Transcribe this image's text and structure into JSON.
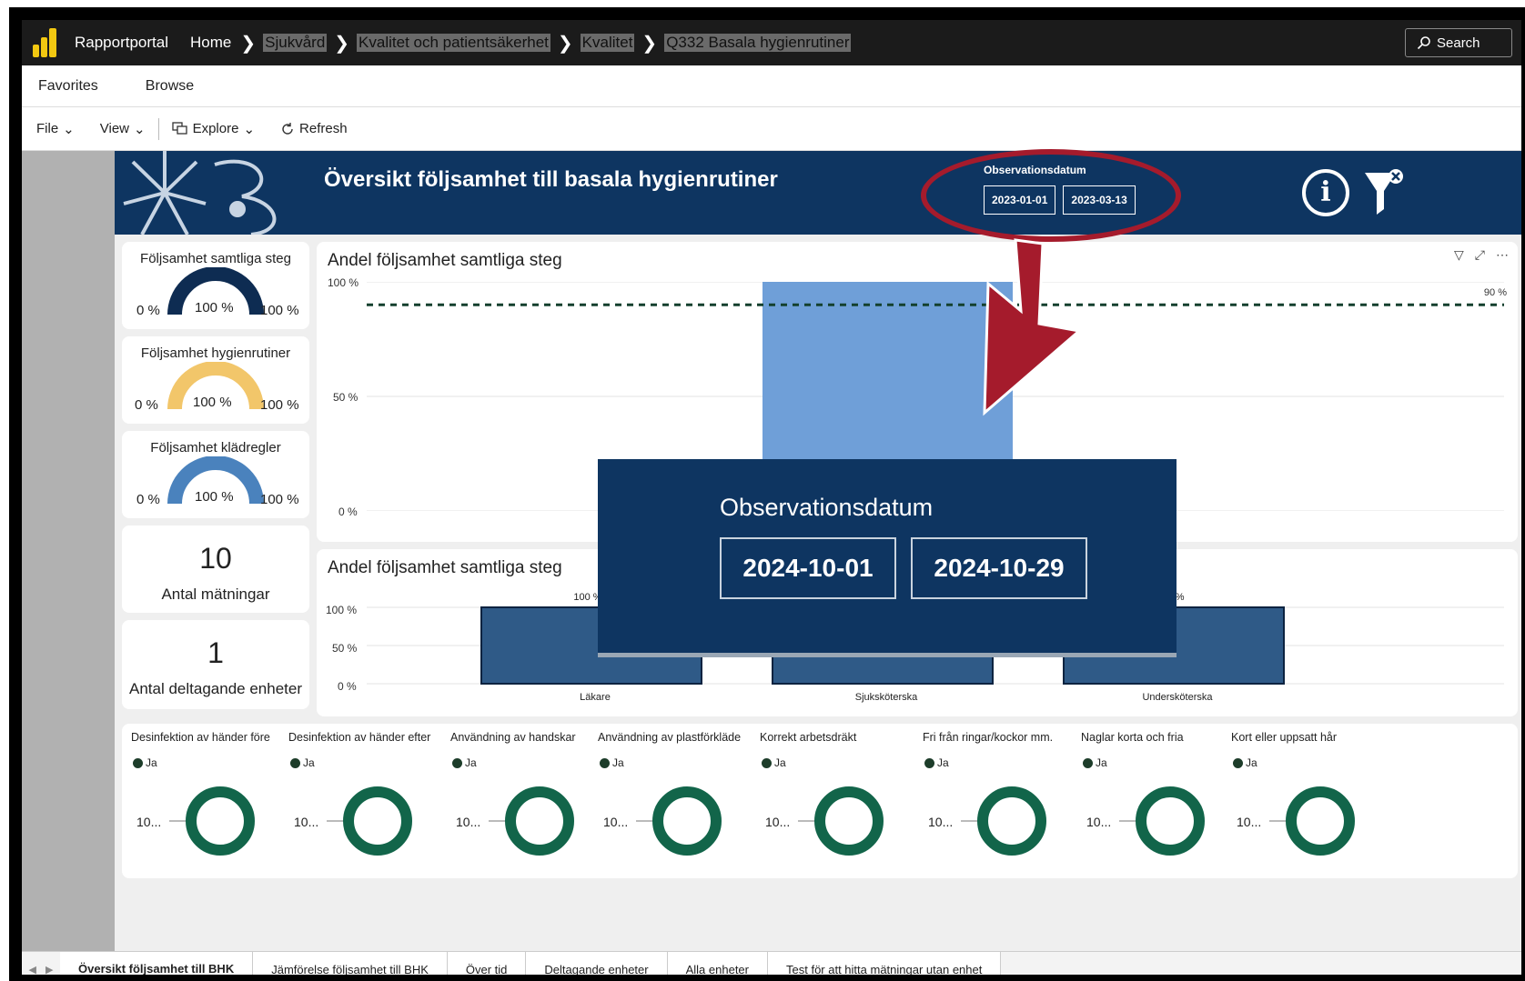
{
  "topbar": {
    "brand": "Rapportportal",
    "breadcrumbs": [
      "Home",
      "Sjukvård",
      "Kvalitet och patientsäkerhet",
      "Kvalitet",
      "Q332 Basala hygienrutiner"
    ],
    "search_label": "Search"
  },
  "nav": {
    "favorites": "Favorites",
    "browse": "Browse"
  },
  "toolbar": {
    "file": "File",
    "view": "View",
    "explore": "Explore",
    "refresh": "Refresh"
  },
  "report": {
    "title": "Översikt följsamhet till basala hygienrutiner",
    "obs_label": "Observationsdatum",
    "date_from": "2023-01-01",
    "date_to": "2023-03-13"
  },
  "zoom_overlay": {
    "label": "Observationsdatum",
    "date_from": "2024-10-01",
    "date_to": "2024-10-29"
  },
  "gauges": [
    {
      "title": "Följsamhet samtliga steg",
      "min": "0 %",
      "max": "100 %",
      "value_label": "100 %",
      "value": 1.0,
      "color": "#0e2c52"
    },
    {
      "title": "Följsamhet hygienrutiner",
      "min": "0 %",
      "max": "100 %",
      "value_label": "100 %",
      "value": 1.0,
      "color": "#f2c66a"
    },
    {
      "title": "Följsamhet klädregler",
      "min": "0 %",
      "max": "100 %",
      "value_label": "100 %",
      "value": 1.0,
      "color": "#4a82bd"
    }
  ],
  "kpis": [
    {
      "value": "10",
      "label": "Antal mätningar"
    },
    {
      "value": "1",
      "label": "Antal deltagande enheter"
    }
  ],
  "chart1": {
    "title": "Andel följsamhet samtliga steg",
    "target_label": "90 %"
  },
  "chart2": {
    "title": "Andel följsamhet samtliga steg"
  },
  "chart_data": [
    {
      "type": "bar",
      "title": "Andel följsamhet samtliga steg",
      "yticks": [
        "100 %",
        "50 %",
        "0 %"
      ],
      "ylim": [
        0,
        100
      ],
      "target": 90,
      "target_label": "90 %",
      "values": [
        100
      ],
      "color": "#6f9fd8",
      "grid": true
    },
    {
      "type": "bar",
      "title": "Andel följsamhet samtliga steg",
      "categories": [
        "Läkare",
        "Sjuksköterska",
        "Undersköterska"
      ],
      "values": [
        100,
        100,
        100
      ],
      "value_labels": [
        "100 %",
        "100 %",
        "100 %"
      ],
      "yticks": [
        "100 %",
        "50 %",
        "0 %"
      ],
      "ylim": [
        0,
        100
      ],
      "color": "#2f5a87",
      "grid": true
    },
    {
      "type": "pie",
      "donuts": [
        {
          "title": "Desinfektion av händer före",
          "legend": "Ja",
          "label": "10..."
        },
        {
          "title": "Desinfektion av händer efter",
          "legend": "Ja",
          "label": "10..."
        },
        {
          "title": "Användning av handskar",
          "legend": "Ja",
          "label": "10..."
        },
        {
          "title": "Användning av plastförkläde",
          "legend": "Ja",
          "label": "10..."
        },
        {
          "title": "Korrekt arbetsdräkt",
          "legend": "Ja",
          "label": "10..."
        },
        {
          "title": "Fri från ringar/kockor mm.",
          "legend": "Ja",
          "label": "10..."
        },
        {
          "title": "Naglar korta och fria",
          "legend": "Ja",
          "label": "10..."
        },
        {
          "title": "Kort eller uppsatt hår",
          "legend": "Ja",
          "label": "10..."
        }
      ],
      "color": "#12654a"
    }
  ],
  "tabs": [
    "Översikt följsamhet till BHK",
    "Jämförelse följsamhet till BHK",
    "Över tid",
    "Deltagande enheter",
    "Alla enheter",
    "Test för att hitta mätningar utan enhet"
  ],
  "colors": {
    "header": "#0e3561",
    "annotation": "#a51b2c",
    "donut": "#12654a"
  }
}
